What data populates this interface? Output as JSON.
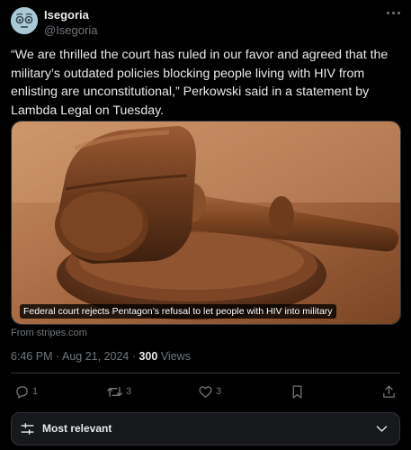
{
  "author": {
    "name": "Isegoria",
    "handle": "@Isegoria"
  },
  "tweet": {
    "text": "“We are thrilled the court has ruled in our favor and agreed that the military’s outdated policies blocking people living with HIV from enlisting are unconstitutional,” Perkowski said in a statement by Lambda Legal on Tuesday."
  },
  "media": {
    "caption": "Federal court rejects Pentagon’s refusal to let people with HIV into military",
    "source": "From stripes.com"
  },
  "meta": {
    "time": "6:46 PM",
    "separator": " · ",
    "date": "Aug 21, 2024",
    "views_count": "300",
    "views_label": "Views"
  },
  "actions": {
    "replies": "1",
    "reposts": "3",
    "likes": "3"
  },
  "sort": {
    "label": "Most relevant"
  },
  "colors": {
    "background": "#000000",
    "text": "#e7e9ea",
    "secondary": "#71767b",
    "border": "#2f3336"
  }
}
